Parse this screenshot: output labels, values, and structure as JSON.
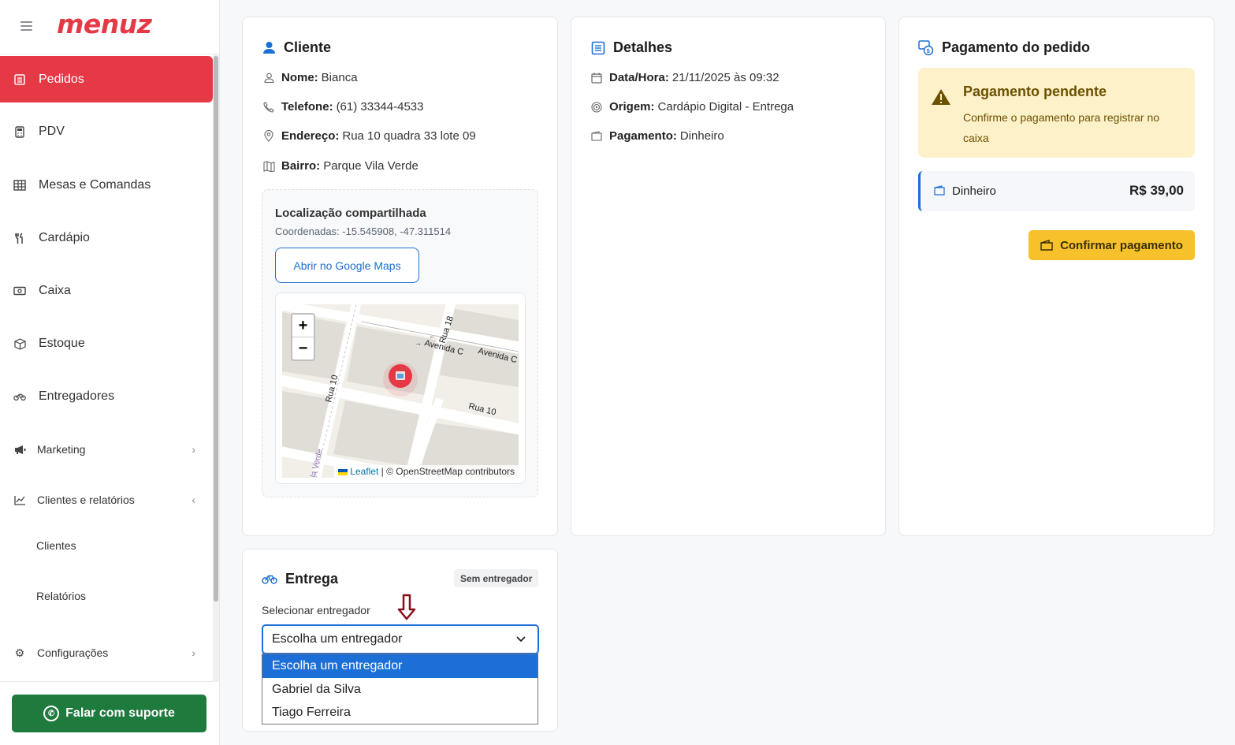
{
  "brand": {
    "logo": "menuz"
  },
  "sidebar": {
    "items": [
      {
        "label": "Pedidos",
        "icon": "list-icon"
      },
      {
        "label": "PDV",
        "icon": "calculator-icon"
      },
      {
        "label": "Mesas e Comandas",
        "icon": "table-icon"
      },
      {
        "label": "Cardápio",
        "icon": "utensils-icon"
      },
      {
        "label": "Caixa",
        "icon": "cash-icon"
      },
      {
        "label": "Estoque",
        "icon": "box-icon"
      },
      {
        "label": "Entregadores",
        "icon": "bicycle-icon"
      },
      {
        "label": "Marketing",
        "icon": "megaphone-icon"
      },
      {
        "label": "Clientes e relatórios",
        "icon": "chart-line-icon"
      },
      {
        "label": "Configurações",
        "icon": "gear-icon"
      }
    ],
    "sub_items": [
      "Clientes",
      "Relatórios"
    ],
    "support_label": "Falar com suporte"
  },
  "cliente": {
    "title": "Cliente",
    "nome_label": "Nome:",
    "nome": "Bianca",
    "telefone_label": "Telefone:",
    "telefone": "(61) 33344-4533",
    "endereco_label": "Endereço:",
    "endereco": "Rua 10 quadra 33 lote 09",
    "bairro_label": "Bairro:",
    "bairro": "Parque Vila Verde",
    "location": {
      "title": "Localização compartilhada",
      "coords": "Coordenadas: -15.545908, -47.311514",
      "maps_button": "Abrir no Google Maps",
      "zoom_in": "+",
      "zoom_out": "−",
      "street_labels": [
        "Rua 18",
        "Avenida C",
        "Avenida C",
        "Rua 10",
        "Rua 10",
        "la Verde"
      ],
      "attribution_link": "Leaflet",
      "attribution_text": " | © OpenStreetMap contributors"
    }
  },
  "detalhes": {
    "title": "Detalhes",
    "data_label": "Data/Hora:",
    "data": "21/11/2025 às 09:32",
    "origem_label": "Origem:",
    "origem": "Cardápio Digital - Entrega",
    "pagamento_label": "Pagamento:",
    "pagamento": "Dinheiro"
  },
  "pagamento": {
    "title": "Pagamento do pedido",
    "warning_title": "Pagamento pendente",
    "warning_text": "Confirme o pagamento para registrar no caixa",
    "method": "Dinheiro",
    "amount": "R$ 39,00",
    "confirm_button": "Confirmar pagamento"
  },
  "entrega": {
    "title": "Entrega",
    "badge": "Sem entregador",
    "select_label": "Selecionar entregador",
    "selected": "Escolha um entregador",
    "options": [
      "Escolha um entregador",
      "Gabriel da Silva",
      "Tiago Ferreira"
    ]
  },
  "colors": {
    "brand": "#e63946",
    "accent": "#1b6fd6",
    "warning_bg": "#fdf1c9",
    "confirm": "#f7c12c",
    "support": "#1f7a3d"
  }
}
